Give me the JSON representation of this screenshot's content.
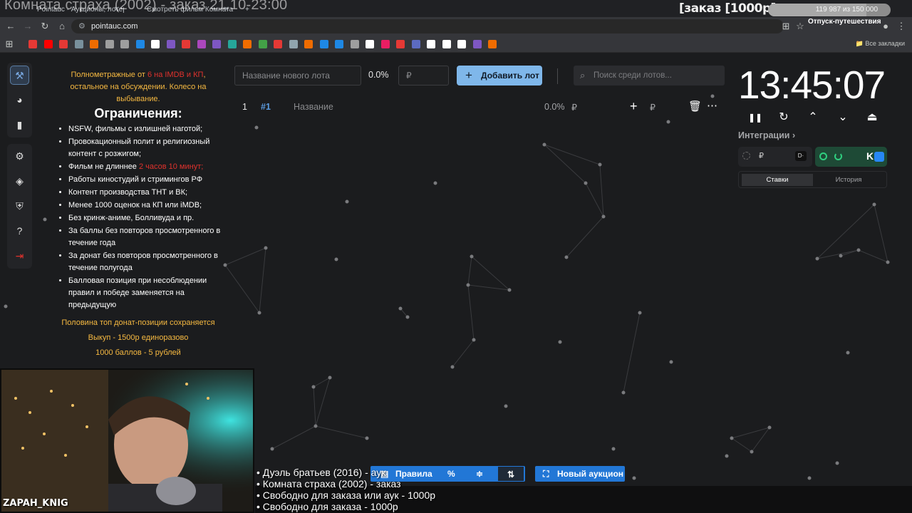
{
  "browser": {
    "tabs": [
      {
        "title": "Pointauc - Аукционы, лотерея",
        "favicon_color": "#4f8df5"
      },
      {
        "title": "Смотреть фильм Комната ст",
        "favicon_color": "#e94b3c"
      }
    ],
    "url": "pointauc.com",
    "bookmarks_all_label": "Все закладки",
    "bookmark_colors": [
      "#e53935",
      "#ff0000",
      "#e53935",
      "#78909c",
      "#ef6c00",
      "#9e9e9e",
      "#9e9e9e",
      "#1e88e5",
      "#ffffff",
      "#7e57c2",
      "#e53935",
      "#ab47bc",
      "#7e57c2",
      "#26a69a",
      "#ef6c00",
      "#43a047",
      "#e53935",
      "#90a4ae",
      "#ef6c00",
      "#1e88e5",
      "#1e88e5",
      "#9e9e9e",
      "#ffffff",
      "#e91e63",
      "#e53935",
      "#5c6bc0",
      "#ffffff",
      "#ffffff",
      "#ffffff",
      "#7e57c2",
      "#ef6c00"
    ]
  },
  "overlay": {
    "title": "Комната страха (2002) - заказ 21.10-23:00",
    "order_label": "[заказ [1000р]",
    "progress": {
      "text": "119 987 из 150 000",
      "fraction": 0.8
    },
    "trip_label": "Отпуск-путешествия"
  },
  "sidebar": {
    "top": [
      {
        "icon": "auction-hammer-icon",
        "glyph": "⚒",
        "active": true
      },
      {
        "icon": "pie-chart-icon",
        "glyph": "◕",
        "active": false
      },
      {
        "icon": "bar-chart-icon",
        "glyph": "▮",
        "active": false
      }
    ],
    "bottom": [
      {
        "icon": "gear-icon",
        "glyph": "⚙"
      },
      {
        "icon": "layers-icon",
        "glyph": "◈"
      },
      {
        "icon": "shield-icon",
        "glyph": "⛨"
      },
      {
        "icon": "help-icon",
        "glyph": "?"
      },
      {
        "icon": "logout-icon",
        "glyph": "⇥"
      }
    ]
  },
  "rules": {
    "intro_before": "Полнометражные от ",
    "intro_red": "6 на IMDB и КП",
    "intro_after": ", остальное на обсуждении. Колесо на выбывание.",
    "heading": "Ограничения:",
    "items": [
      "NSFW, фильмы с излишней наготой;",
      "Провокационный полит и религиозный контент с розжигом;",
      "__runtime__",
      "Работы киностудий и стримингов РФ",
      "Контент производства ТНТ и ВК;",
      "Менее 1000 оценок на КП или iMDB;",
      "Без кринж-аниме, Болливуда и пр.",
      "За баллы без повторов просмотренного в течение года",
      "За донат без повторов просмотренного в течение полугода",
      "Балловая позиция при несоблюдении правил и победе заменяется на предыдущую"
    ],
    "runtime_before": "Фильм не длиннее ",
    "runtime_red": "2 часов 10 минут;",
    "footer": [
      "Половина топ донат-позиции сохраняется",
      "Выкуп - 1500р единоразово",
      "1000 баллов - 5 рублей"
    ]
  },
  "toolbar": {
    "lot_name_placeholder": "Название нового лота",
    "percent": "0.0%",
    "currency": "₽",
    "add_lot_label": "Добавить лот",
    "search_placeholder": "Поиск среди лотов..."
  },
  "lot_row": {
    "index": "1",
    "number": "#1",
    "name_placeholder": "Название",
    "percent": "0.0%",
    "currency": "₽",
    "amount_currency": "₽"
  },
  "timer": {
    "value": "13:45:07",
    "controls": [
      {
        "icon": "pause-icon",
        "glyph": "❚❚"
      },
      {
        "icon": "restart-icon",
        "glyph": "↻"
      },
      {
        "icon": "chevron-up-icon",
        "glyph": "⌃"
      },
      {
        "icon": "chevron-down-icon",
        "glyph": "⌄"
      },
      {
        "icon": "eject-icon",
        "glyph": "⏏"
      }
    ]
  },
  "integrations": {
    "label": "Интеграции",
    "chevron": "›",
    "donation_currency": "₽",
    "tabs": [
      "Ставки",
      "История"
    ],
    "vk_label": "K"
  },
  "bottom": {
    "rules_label": "Правила",
    "new_auction_label": "Новый аукцион",
    "ticker": [
      "• Дуэль братьев (2016) - аук",
      "• Комната страха (2002) - заказ",
      "• Свободно для заказа или аук - 1000р",
      "• Свободно для заказа - 1000р"
    ],
    "streamer_name": "ZAPAH_KNIG"
  },
  "colors": {
    "accent": "#7fb7ea",
    "blue_bar": "#2277d6",
    "orange_text": "#f6b941",
    "red_text": "#e0322d",
    "bg": "#1b1c1e"
  }
}
